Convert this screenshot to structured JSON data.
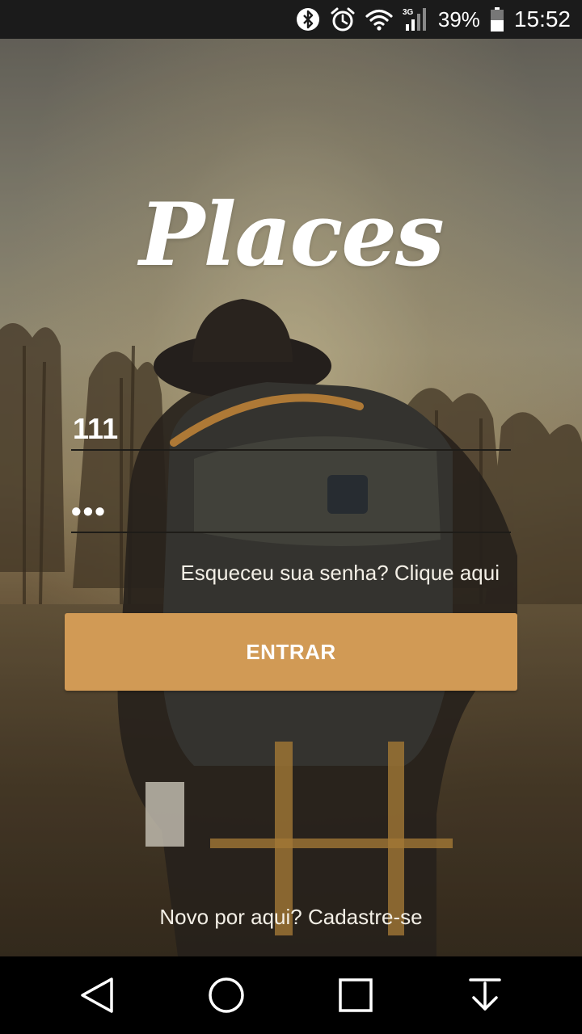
{
  "status_bar": {
    "icons": [
      "bluetooth-icon",
      "alarm-icon",
      "wifi-icon",
      "signal-3g-icon",
      "battery-icon"
    ],
    "network_label": "3G",
    "battery_percent": "39%",
    "time": "15:52"
  },
  "app": {
    "logo_text": "Places"
  },
  "login_form": {
    "username_value": "111",
    "password_mask": "•••",
    "forgot_password_text": "Esqueceu sua senha? Clique aqui",
    "submit_label": "ENTRAR",
    "signup_text": "Novo por aqui? Cadastre-se"
  },
  "nav_bar": {
    "buttons": [
      "back-triangle-icon",
      "home-circle-icon",
      "recents-square-icon",
      "notification-pull-icon"
    ]
  },
  "colors": {
    "button": "#d19a55",
    "status_bar": "#1b1b1b",
    "nav_bar": "#000000"
  }
}
